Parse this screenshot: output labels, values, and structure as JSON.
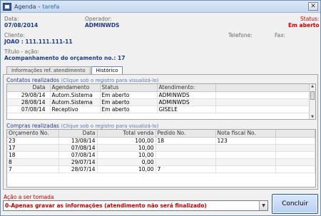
{
  "window": {
    "app": "Agenda",
    "sep": "-",
    "subtitle": "tarefa",
    "close": "✕"
  },
  "header": {
    "data_label": "Data:",
    "data_value": "07/08/2014",
    "operador_label": "Operador:",
    "operador_value": "ADMINWDS",
    "status_label": "Status:",
    "status_value": "Em aberto",
    "cliente_label": "Cliente:",
    "cliente_value": "JOAO : 111.111.111-11",
    "telefone_label": "Telefone:",
    "fax_label": "Fax:",
    "titulo_label": "Título - ação:",
    "titulo_value": "Acompanhamento do orçamento no.: 17"
  },
  "tabs": [
    {
      "label": "Informações ref. atendimento",
      "active": false
    },
    {
      "label": "Histórico",
      "active": true
    }
  ],
  "contatos": {
    "title": "Contatos realizados",
    "hint": "(Clique sob o registro para visualizá-lo)",
    "columns": [
      "Data",
      "Agendamento",
      "Status",
      "Atendimento:"
    ],
    "rows": [
      [
        "29/08/14",
        "Autom.Sistema",
        "Em aberto",
        "ADMINWDS"
      ],
      [
        "28/08/14",
        "Autom.Sistema",
        "Em aberto",
        "ADMINWDS"
      ],
      [
        "07/08/14",
        "Receptivo",
        "Em aberto",
        "GISELE"
      ]
    ]
  },
  "compras": {
    "title": "Compras realizadas",
    "hint": "(Clique sob o registro para visualizá-lo)",
    "columns": [
      "Orçamento No.",
      "Data",
      "Total venda",
      "Pedido No.",
      "Nota fiscal No."
    ],
    "rows": [
      [
        "23",
        "13/08/14",
        "100,00",
        "18",
        "123"
      ],
      [
        "17",
        "07/08/14",
        "10,00",
        "",
        ""
      ],
      [
        "18",
        "07/08/14",
        "10,00",
        "",
        ""
      ],
      [
        "8",
        "29/07/14",
        "0,00",
        "",
        ""
      ],
      [
        "7",
        "28/07/14",
        "10,00",
        "7",
        ""
      ]
    ]
  },
  "action": {
    "label": "Ação a ser tomada",
    "selected": "0-Apenas gravar as informações (atendimento não será finalizado)",
    "drop_glyph": "▼"
  },
  "buttons": {
    "concluir": "Concluir"
  },
  "colors": {
    "accent": "#1f3c8a",
    "status_red": "#d00000",
    "title_bar": "#c5d8ef"
  }
}
